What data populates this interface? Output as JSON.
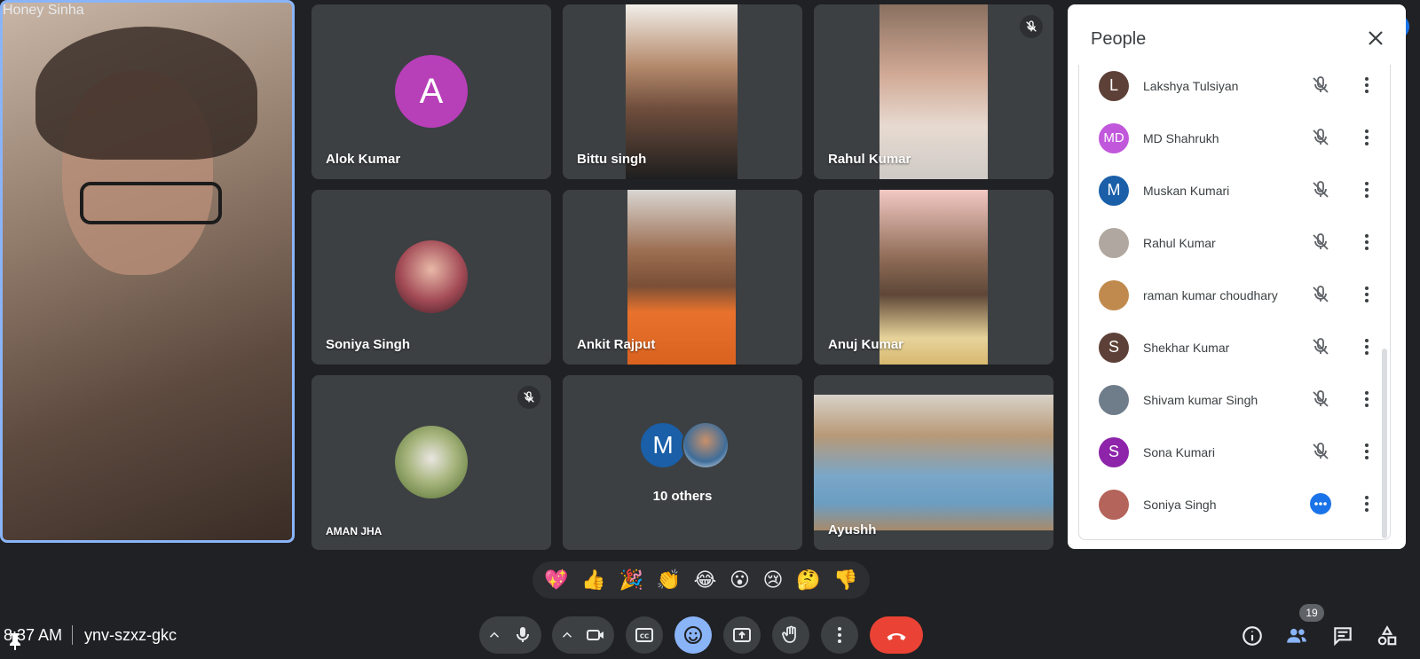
{
  "main_speaker": {
    "name": "Honey Sinha",
    "pin_icon": "pin-icon",
    "speaking_icon": "speaking-indicator-icon"
  },
  "tiles": [
    {
      "name": "Alok Kumar",
      "type": "avatar",
      "initial": "A",
      "color": "#b73fb8"
    },
    {
      "name": "Bittu singh",
      "type": "video"
    },
    {
      "name": "Rahul Kumar",
      "type": "video",
      "muted": true
    },
    {
      "name": "Soniya Singh",
      "type": "photo"
    },
    {
      "name": "Ankit Rajput",
      "type": "video"
    },
    {
      "name": "Anuj Kumar",
      "type": "video"
    },
    {
      "name": "AMAN JHA",
      "type": "photo",
      "muted": true
    },
    {
      "name": "10 others",
      "type": "group",
      "initial": "M",
      "color": "#1a5fa8"
    },
    {
      "name": "Ayushh",
      "type": "video"
    }
  ],
  "people_panel": {
    "title": "People",
    "participants": [
      {
        "name": "Lakshya Tulsiyan",
        "initial": "L",
        "color": "#5d4037",
        "status": "muted"
      },
      {
        "name": "MD Shahrukh",
        "initial": "MD",
        "color": "#c158dc",
        "status": "muted"
      },
      {
        "name": "Muskan Kumari",
        "initial": "M",
        "color": "#1a5fa8",
        "status": "muted"
      },
      {
        "name": "Rahul Kumar",
        "initial": "",
        "color": "#b0a8a0",
        "status": "muted"
      },
      {
        "name": "raman kumar choudhary",
        "initial": "",
        "color": "#c08a4f",
        "status": "muted"
      },
      {
        "name": "Shekhar Kumar",
        "initial": "S",
        "color": "#5d4037",
        "status": "muted"
      },
      {
        "name": "Shivam kumar Singh",
        "initial": "",
        "color": "#6f7c8a",
        "status": "muted"
      },
      {
        "name": "Sona Kumari",
        "initial": "S",
        "color": "#8e24aa",
        "status": "muted"
      },
      {
        "name": "Soniya Singh",
        "initial": "",
        "color": "#b4645a",
        "status": "speaking"
      }
    ]
  },
  "reactions": [
    "💖",
    "👍",
    "🎉",
    "👏",
    "😂",
    "😮",
    "😢",
    "🤔",
    "👎"
  ],
  "bottom_bar": {
    "time": "8:37 AM",
    "meeting_code": "ynv-szxz-gkc",
    "people_count": "19"
  },
  "colors": {
    "accent": "#8ab4f8",
    "end_call": "#ea4335",
    "panel_bg": "#ffffff",
    "tile_bg": "#3c4043"
  }
}
